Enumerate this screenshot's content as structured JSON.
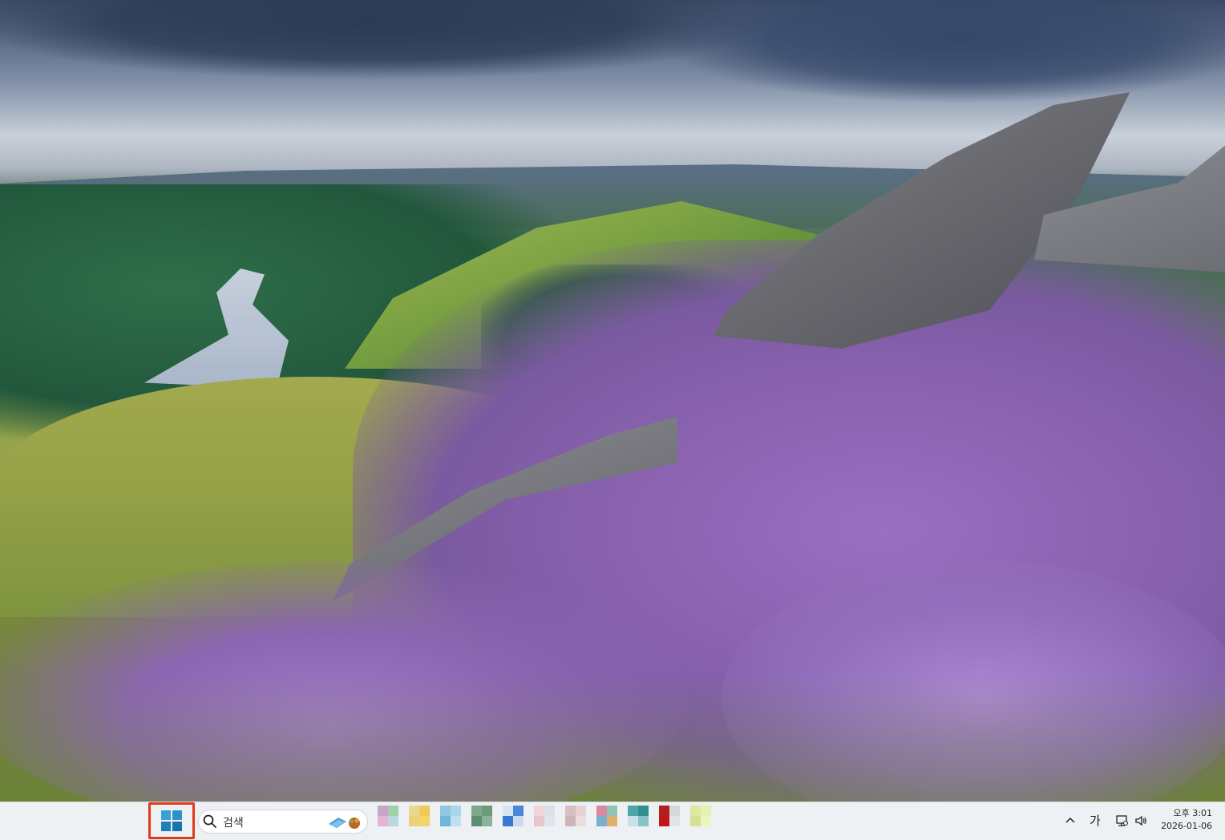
{
  "desktop": {
    "wallpaper": "heather-moorland-reservoir-landscape"
  },
  "taskbar": {
    "start_button": {
      "icon": "windows-logo-icon",
      "highlight_color": "#e5391c"
    },
    "search": {
      "placeholder": "검색",
      "icon": "search-icon"
    },
    "pinned_apps": [
      {
        "name": "app-1",
        "colors": [
          "#c7a4c8",
          "#9fd0a8",
          "#e2b5d2",
          "#b8d8e0"
        ]
      },
      {
        "name": "app-2",
        "colors": [
          "#e8d98f",
          "#f0c95a",
          "#e9d27a",
          "#f5d56a"
        ]
      },
      {
        "name": "app-3",
        "colors": [
          "#8fc8e0",
          "#a9d6e8",
          "#6fb6d8",
          "#bfe0ee"
        ]
      },
      {
        "name": "app-4",
        "colors": [
          "#7fa88f",
          "#6b9a7d",
          "#5f8f72",
          "#8cb39a"
        ]
      },
      {
        "name": "app-5",
        "colors": [
          "#d9e4f0",
          "#4a86d9",
          "#3b78d0",
          "#cbdbea"
        ]
      },
      {
        "name": "app-6",
        "colors": [
          "#f0d6da",
          "#d8e0ea",
          "#e8c4cc",
          "#dfe5ec"
        ]
      },
      {
        "name": "app-7",
        "colors": [
          "#d6c0c4",
          "#e6d2d4",
          "#cdb6ba",
          "#eddcde"
        ]
      },
      {
        "name": "app-8",
        "colors": [
          "#d88aa0",
          "#8fc4b4",
          "#7ab0d0",
          "#e0b070"
        ]
      },
      {
        "name": "app-9",
        "colors": [
          "#4aa8a8",
          "#2f9090",
          "#c8e0e8",
          "#86c2c8"
        ]
      },
      {
        "name": "app-10",
        "colors": [
          "#b02020",
          "#d8d8d8",
          "#c01818",
          "#e4e4e4"
        ]
      },
      {
        "name": "app-11",
        "colors": [
          "#dfe8a0",
          "#e8f0b0",
          "#d6e290",
          "#eef4c0"
        ]
      }
    ],
    "tray": {
      "chevron_icon": "chevron-up-icon",
      "ime_label": "가",
      "network_icon": "network-icon",
      "volume_icon": "volume-icon",
      "time": "오후 3:01",
      "date": "2026-01-06"
    }
  }
}
